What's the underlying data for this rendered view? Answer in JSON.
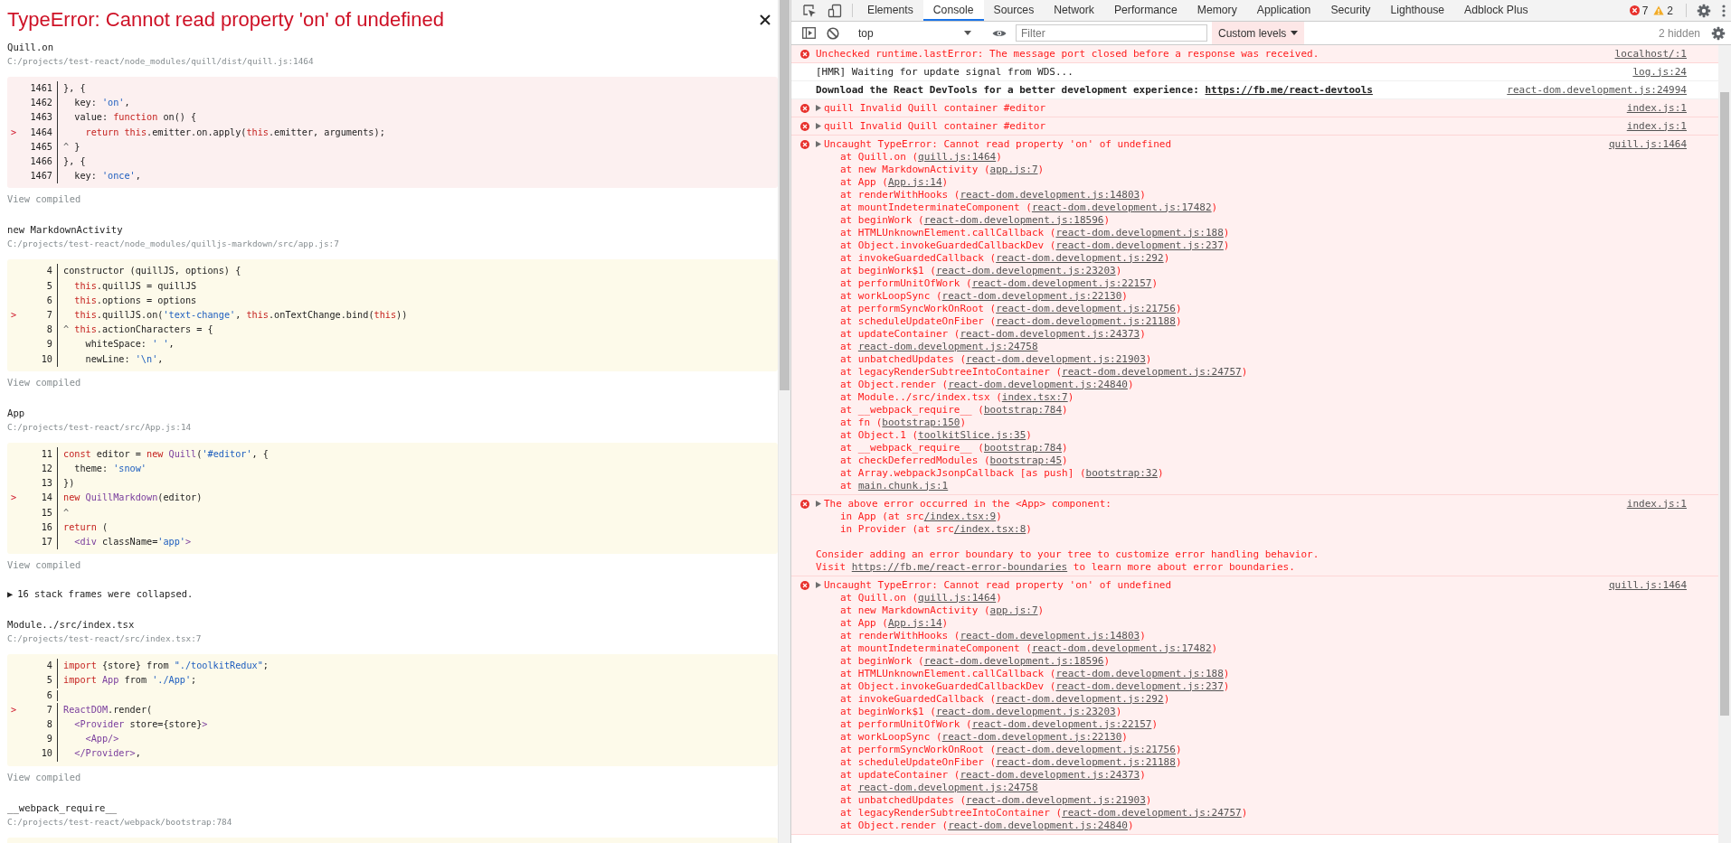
{
  "overlay": {
    "title": "TypeError: Cannot read property 'on' of undefined",
    "sections": [
      {
        "kind": "frame",
        "name": "Quill.on",
        "path": "C:/projects/test-react/node_modules/quill/dist/quill.js:1464",
        "color": "#fcf0f0",
        "view_compiled": "View compiled",
        "lines": [
          {
            "num": "1461",
            "tokens": [
              {
                "kind": "plain",
                "text": "}, {"
              }
            ]
          },
          {
            "num": "1462",
            "tokens": [
              {
                "kind": "plain",
                "text": "  key: "
              },
              {
                "kind": "string",
                "text": "'on'"
              },
              {
                "kind": "plain",
                "text": ","
              }
            ]
          },
          {
            "num": "1463",
            "tokens": [
              {
                "kind": "plain",
                "text": "  value: "
              },
              {
                "kind": "keyword",
                "text": "function"
              },
              {
                "kind": "plain",
                "text": " on() {"
              }
            ]
          },
          {
            "num": "1464",
            "marker": ">",
            "tokens": [
              {
                "kind": "keyword",
                "text": "    return"
              },
              {
                "kind": "keyword",
                "text": " this"
              },
              {
                "kind": "plain",
                "text": ".emitter.on.apply("
              },
              {
                "kind": "keyword",
                "text": "this"
              },
              {
                "kind": "plain",
                "text": ".emitter, arguments);"
              }
            ]
          },
          {
            "num": "1465",
            "tokens": [
              {
                "kind": "caret",
                "text": "^ "
              },
              {
                "kind": "plain",
                "text": "}"
              }
            ]
          },
          {
            "num": "1466",
            "tokens": [
              {
                "kind": "plain",
                "text": "}, {"
              }
            ]
          },
          {
            "num": "1467",
            "tokens": [
              {
                "kind": "plain",
                "text": "  key: "
              },
              {
                "kind": "string",
                "text": "'once'"
              },
              {
                "kind": "plain",
                "text": ","
              }
            ]
          }
        ]
      },
      {
        "kind": "frame",
        "name": "new MarkdownActivity",
        "path": "C:/projects/test-react/node_modules/quilljs-markdown/src/app.js:7",
        "color": "#fdfaea",
        "view_compiled": "View compiled",
        "lines": [
          {
            "num": "4",
            "tokens": [
              {
                "kind": "plain",
                "text": "constructor (quillJS, options) {"
              }
            ]
          },
          {
            "num": "5",
            "tokens": [
              {
                "kind": "keyword",
                "text": "  this"
              },
              {
                "kind": "plain",
                "text": ".quillJS = quillJS"
              }
            ]
          },
          {
            "num": "6",
            "tokens": [
              {
                "kind": "keyword",
                "text": "  this"
              },
              {
                "kind": "plain",
                "text": ".options = options"
              }
            ]
          },
          {
            "num": "7",
            "marker": ">",
            "tokens": [
              {
                "kind": "keyword",
                "text": "  this"
              },
              {
                "kind": "plain",
                "text": ".quillJS.on("
              },
              {
                "kind": "string",
                "text": "'text-change'"
              },
              {
                "kind": "plain",
                "text": ", "
              },
              {
                "kind": "keyword",
                "text": "this"
              },
              {
                "kind": "plain",
                "text": ".onTextChange.bind("
              },
              {
                "kind": "keyword",
                "text": "this"
              },
              {
                "kind": "plain",
                "text": "))"
              }
            ]
          },
          {
            "num": "8",
            "tokens": [
              {
                "kind": "caret",
                "text": "^ "
              },
              {
                "kind": "keyword",
                "text": "this"
              },
              {
                "kind": "plain",
                "text": ".actionCharacters = {"
              }
            ]
          },
          {
            "num": "9",
            "tokens": [
              {
                "kind": "plain",
                "text": "    whiteSpace: "
              },
              {
                "kind": "string",
                "text": "' '"
              },
              {
                "kind": "plain",
                "text": ","
              }
            ]
          },
          {
            "num": "10",
            "tokens": [
              {
                "kind": "plain",
                "text": "    newLine: "
              },
              {
                "kind": "string",
                "text": "'\\n'"
              },
              {
                "kind": "plain",
                "text": ","
              }
            ]
          }
        ]
      },
      {
        "kind": "frame",
        "name": "App",
        "path": "C:/projects/test-react/src/App.js:14",
        "color": "#fdfaea",
        "view_compiled": "View compiled",
        "lines": [
          {
            "num": "11",
            "tokens": [
              {
                "kind": "keyword",
                "text": "const"
              },
              {
                "kind": "plain",
                "text": " editor = "
              },
              {
                "kind": "keyword",
                "text": "new"
              },
              {
                "kind": "name",
                "text": " Quill"
              },
              {
                "kind": "plain",
                "text": "("
              },
              {
                "kind": "string",
                "text": "'#editor'"
              },
              {
                "kind": "plain",
                "text": ", {"
              }
            ]
          },
          {
            "num": "12",
            "tokens": [
              {
                "kind": "plain",
                "text": "  theme: "
              },
              {
                "kind": "string",
                "text": "'snow'"
              }
            ]
          },
          {
            "num": "13",
            "tokens": [
              {
                "kind": "plain",
                "text": "})"
              }
            ]
          },
          {
            "num": "14",
            "marker": ">",
            "tokens": [
              {
                "kind": "keyword",
                "text": "new"
              },
              {
                "kind": "name",
                "text": " QuillMarkdown"
              },
              {
                "kind": "plain",
                "text": "(editor)"
              }
            ]
          },
          {
            "num": "15",
            "tokens": [
              {
                "kind": "caret",
                "text": "^"
              }
            ]
          },
          {
            "num": "16",
            "tokens": [
              {
                "kind": "keyword",
                "text": "return"
              },
              {
                "kind": "plain",
                "text": " ("
              }
            ]
          },
          {
            "num": "17",
            "tokens": [
              {
                "kind": "name",
                "text": "  <div"
              },
              {
                "kind": "plain",
                "text": " className="
              },
              {
                "kind": "string",
                "text": "'app'"
              },
              {
                "kind": "name",
                "text": ">"
              }
            ]
          }
        ]
      },
      {
        "kind": "collapsed",
        "toggle": "▶",
        "text": "16 stack frames were collapsed."
      },
      {
        "kind": "frame",
        "name": "Module../src/index.tsx",
        "path": "C:/projects/test-react/src/index.tsx:7",
        "color": "#fdfaea",
        "view_compiled": "View compiled",
        "lines": [
          {
            "num": "4",
            "tokens": [
              {
                "kind": "keyword",
                "text": "import"
              },
              {
                "kind": "plain",
                "text": " {store} from "
              },
              {
                "kind": "string",
                "text": "\"./toolkitRedux\""
              },
              {
                "kind": "plain",
                "text": ";"
              }
            ]
          },
          {
            "num": "5",
            "tokens": [
              {
                "kind": "keyword",
                "text": "import"
              },
              {
                "kind": "name",
                "text": " App"
              },
              {
                "kind": "plain",
                "text": " from "
              },
              {
                "kind": "string",
                "text": "'./App'"
              },
              {
                "kind": "plain",
                "text": ";"
              }
            ]
          },
          {
            "num": "6"
          },
          {
            "num": "7",
            "marker": ">",
            "tokens": [
              {
                "kind": "name",
                "text": "ReactDOM"
              },
              {
                "kind": "plain",
                "text": ".render("
              }
            ]
          },
          {
            "num": "8",
            "tokens": [
              {
                "kind": "name",
                "text": "  <Provider"
              },
              {
                "kind": "plain",
                "text": " store={store}"
              },
              {
                "kind": "name",
                "text": ">"
              }
            ]
          },
          {
            "num": "9",
            "tokens": [
              {
                "kind": "name",
                "text": "    <App/>"
              }
            ]
          },
          {
            "num": "10",
            "tokens": [
              {
                "kind": "name",
                "text": "  </Provider>"
              },
              {
                "kind": "plain",
                "text": ","
              }
            ]
          }
        ]
      },
      {
        "kind": "frame",
        "name": "__webpack_require__",
        "path": "C:/projects/test-react/webpack/bootstrap:784",
        "color": "#fdfaea"
      }
    ]
  },
  "devtools": {
    "tabs": [
      {
        "label": "Elements",
        "selected": false
      },
      {
        "label": "Console",
        "selected": true
      },
      {
        "label": "Sources",
        "selected": false
      },
      {
        "label": "Network",
        "selected": false
      },
      {
        "label": "Performance",
        "selected": false
      },
      {
        "label": "Memory",
        "selected": false
      },
      {
        "label": "Application",
        "selected": false
      },
      {
        "label": "Security",
        "selected": false
      },
      {
        "label": "Lighthouse",
        "selected": false
      },
      {
        "label": "Adblock Plus",
        "selected": false
      }
    ],
    "errors": "7",
    "warnings": "2",
    "toolbar": {
      "context": "top",
      "filter_placeholder": "Filter",
      "levels": "Custom levels",
      "hidden": "2 hidden"
    },
    "messages": [
      {
        "kind": "error",
        "expandable": false,
        "bold": false,
        "source": "localhost/:1",
        "lines": [
          {
            "kind": "head",
            "text": "Unchecked runtime.lastError: The message port closed before a response was received."
          }
        ]
      },
      {
        "kind": "log",
        "expandable": false,
        "bold": false,
        "source": "log.js:24",
        "lines": [
          {
            "kind": "head",
            "text": "[HMR] Waiting for update signal from WDS..."
          }
        ]
      },
      {
        "kind": "log",
        "expandable": false,
        "bold": true,
        "source": "react-dom.development.js:24994",
        "lines": [
          {
            "kind": "head",
            "text": "Download the React DevTools for a better development experience: ",
            "link": "https://fb.me/react-devtools"
          }
        ]
      },
      {
        "kind": "error",
        "expandable": true,
        "bold": false,
        "source": "index.js:1",
        "lines": [
          {
            "kind": "head",
            "text": "quill Invalid Quill container #editor"
          }
        ]
      },
      {
        "kind": "error",
        "expandable": true,
        "bold": false,
        "source": "index.js:1",
        "lines": [
          {
            "kind": "head",
            "text": "quill Invalid Quill container #editor"
          }
        ]
      },
      {
        "kind": "error",
        "expandable": true,
        "bold": false,
        "source": "quill.js:1464",
        "lines": [
          {
            "kind": "head",
            "text": "Uncaught TypeError: Cannot read property 'on' of undefined"
          },
          {
            "kind": "stack",
            "text": "at Quill.on (",
            "link": "quill.js:1464",
            "after": ")"
          },
          {
            "kind": "stack",
            "text": "at new MarkdownActivity (",
            "link": "app.js:7",
            "after": ")"
          },
          {
            "kind": "stack",
            "text": "at App (",
            "link": "App.js:14",
            "after": ")"
          },
          {
            "kind": "stack",
            "text": "at renderWithHooks (",
            "link": "react-dom.development.js:14803",
            "after": ")"
          },
          {
            "kind": "stack",
            "text": "at mountIndeterminateComponent (",
            "link": "react-dom.development.js:17482",
            "after": ")"
          },
          {
            "kind": "stack",
            "text": "at beginWork (",
            "link": "react-dom.development.js:18596",
            "after": ")"
          },
          {
            "kind": "stack",
            "text": "at HTMLUnknownElement.callCallback (",
            "link": "react-dom.development.js:188",
            "after": ")"
          },
          {
            "kind": "stack",
            "text": "at Object.invokeGuardedCallbackDev (",
            "link": "react-dom.development.js:237",
            "after": ")"
          },
          {
            "kind": "stack",
            "text": "at invokeGuardedCallback (",
            "link": "react-dom.development.js:292",
            "after": ")"
          },
          {
            "kind": "stack",
            "text": "at beginWork$1 (",
            "link": "react-dom.development.js:23203",
            "after": ")"
          },
          {
            "kind": "stack",
            "text": "at performUnitOfWork (",
            "link": "react-dom.development.js:22157",
            "after": ")"
          },
          {
            "kind": "stack",
            "text": "at workLoopSync (",
            "link": "react-dom.development.js:22130",
            "after": ")"
          },
          {
            "kind": "stack",
            "text": "at performSyncWorkOnRoot (",
            "link": "react-dom.development.js:21756",
            "after": ")"
          },
          {
            "kind": "stack",
            "text": "at scheduleUpdateOnFiber (",
            "link": "react-dom.development.js:21188",
            "after": ")"
          },
          {
            "kind": "stack",
            "text": "at updateContainer (",
            "link": "react-dom.development.js:24373",
            "after": ")"
          },
          {
            "kind": "stack",
            "text": "at ",
            "link": "react-dom.development.js:24758"
          },
          {
            "kind": "stack",
            "text": "at unbatchedUpdates (",
            "link": "react-dom.development.js:21903",
            "after": ")"
          },
          {
            "kind": "stack",
            "text": "at legacyRenderSubtreeIntoContainer (",
            "link": "react-dom.development.js:24757",
            "after": ")"
          },
          {
            "kind": "stack",
            "text": "at Object.render (",
            "link": "react-dom.development.js:24840",
            "after": ")"
          },
          {
            "kind": "stack",
            "text": "at Module../src/index.tsx (",
            "link": "index.tsx:7",
            "after": ")"
          },
          {
            "kind": "stack",
            "text": "at __webpack_require__ (",
            "link": "bootstrap:784",
            "after": ")"
          },
          {
            "kind": "stack",
            "text": "at fn (",
            "link": "bootstrap:150",
            "after": ")"
          },
          {
            "kind": "stack",
            "text": "at Object.1 (",
            "link": "toolkitSlice.js:35",
            "after": ")"
          },
          {
            "kind": "stack",
            "text": "at __webpack_require__ (",
            "link": "bootstrap:784",
            "after": ")"
          },
          {
            "kind": "stack",
            "text": "at checkDeferredModules (",
            "link": "bootstrap:45",
            "after": ")"
          },
          {
            "kind": "stack",
            "text": "at Array.webpackJsonpCallback [as push] (",
            "link": "bootstrap:32",
            "after": ")"
          },
          {
            "kind": "stack",
            "text": "at ",
            "link": "main.chunk.js:1"
          }
        ]
      },
      {
        "kind": "error",
        "expandable": true,
        "bold": false,
        "source": "index.js:1",
        "lines": [
          {
            "kind": "head",
            "text": "The above error occurred in the <App> component:"
          },
          {
            "kind": "stack",
            "text": "in App (at src",
            "link": "/index.tsx:9",
            "after": ")"
          },
          {
            "kind": "stack",
            "text": "in Provider (at src",
            "link": "/index.tsx:8",
            "after": ")"
          },
          {
            "kind": "blank"
          },
          {
            "kind": "note",
            "text": "Consider adding an error boundary to your tree to customize error handling behavior."
          },
          {
            "kind": "note",
            "text": "Visit ",
            "link": "https://fb.me/react-error-boundaries",
            "after": " to learn more about error boundaries."
          }
        ]
      },
      {
        "kind": "error",
        "expandable": true,
        "bold": false,
        "source": "quill.js:1464",
        "lines": [
          {
            "kind": "head",
            "text": "Uncaught TypeError: Cannot read property 'on' of undefined"
          },
          {
            "kind": "stack",
            "text": "at Quill.on (",
            "link": "quill.js:1464",
            "after": ")"
          },
          {
            "kind": "stack",
            "text": "at new MarkdownActivity (",
            "link": "app.js:7",
            "after": ")"
          },
          {
            "kind": "stack",
            "text": "at App (",
            "link": "App.js:14",
            "after": ")"
          },
          {
            "kind": "stack",
            "text": "at renderWithHooks (",
            "link": "react-dom.development.js:14803",
            "after": ")"
          },
          {
            "kind": "stack",
            "text": "at mountIndeterminateComponent (",
            "link": "react-dom.development.js:17482",
            "after": ")"
          },
          {
            "kind": "stack",
            "text": "at beginWork (",
            "link": "react-dom.development.js:18596",
            "after": ")"
          },
          {
            "kind": "stack",
            "text": "at HTMLUnknownElement.callCallback (",
            "link": "react-dom.development.js:188",
            "after": ")"
          },
          {
            "kind": "stack",
            "text": "at Object.invokeGuardedCallbackDev (",
            "link": "react-dom.development.js:237",
            "after": ")"
          },
          {
            "kind": "stack",
            "text": "at invokeGuardedCallback (",
            "link": "react-dom.development.js:292",
            "after": ")"
          },
          {
            "kind": "stack",
            "text": "at beginWork$1 (",
            "link": "react-dom.development.js:23203",
            "after": ")"
          },
          {
            "kind": "stack",
            "text": "at performUnitOfWork (",
            "link": "react-dom.development.js:22157",
            "after": ")"
          },
          {
            "kind": "stack",
            "text": "at workLoopSync (",
            "link": "react-dom.development.js:22130",
            "after": ")"
          },
          {
            "kind": "stack",
            "text": "at performSyncWorkOnRoot (",
            "link": "react-dom.development.js:21756",
            "after": ")"
          },
          {
            "kind": "stack",
            "text": "at scheduleUpdateOnFiber (",
            "link": "react-dom.development.js:21188",
            "after": ")"
          },
          {
            "kind": "stack",
            "text": "at updateContainer (",
            "link": "react-dom.development.js:24373",
            "after": ")"
          },
          {
            "kind": "stack",
            "text": "at ",
            "link": "react-dom.development.js:24758"
          },
          {
            "kind": "stack",
            "text": "at unbatchedUpdates (",
            "link": "react-dom.development.js:21903",
            "after": ")"
          },
          {
            "kind": "stack",
            "text": "at legacyRenderSubtreeIntoContainer (",
            "link": "react-dom.development.js:24757",
            "after": ")"
          },
          {
            "kind": "stack",
            "text": "at Object.render (",
            "link": "react-dom.development.js:24840",
            "after": ")"
          }
        ]
      }
    ]
  }
}
